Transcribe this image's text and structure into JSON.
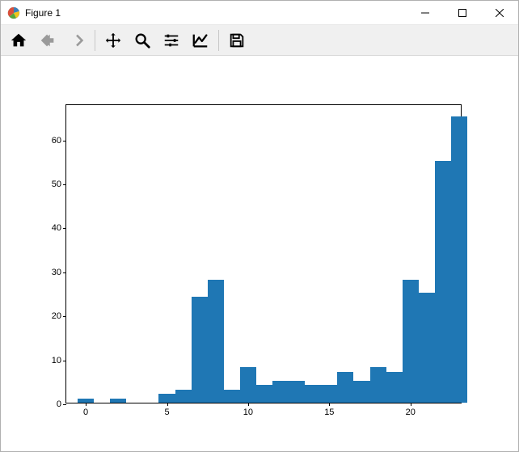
{
  "window": {
    "title": "Figure 1"
  },
  "toolbar": {
    "home": "Home",
    "back": "Back",
    "forward": "Forward",
    "pan": "Pan",
    "zoom": "Zoom",
    "subplots": "Configure subplots",
    "axes": "Edit axis",
    "save": "Save"
  },
  "chart_data": {
    "type": "bar",
    "xlim": [
      -1.2,
      23.2
    ],
    "ylim": [
      0,
      68
    ],
    "x_ticks": [
      0,
      5,
      10,
      15,
      20
    ],
    "y_ticks": [
      0,
      10,
      20,
      30,
      40,
      50,
      60
    ],
    "x_tick_labels": [
      "0",
      "5",
      "10",
      "15",
      "20"
    ],
    "y_tick_labels": [
      "0",
      "10",
      "20",
      "30",
      "40",
      "50",
      "60"
    ],
    "bars": [
      {
        "x": 0,
        "h": 1
      },
      {
        "x": 2,
        "h": 1
      },
      {
        "x": 5,
        "h": 2
      },
      {
        "x": 6,
        "h": 3
      },
      {
        "x": 7,
        "h": 24
      },
      {
        "x": 8,
        "h": 28
      },
      {
        "x": 9,
        "h": 3
      },
      {
        "x": 10,
        "h": 8
      },
      {
        "x": 11,
        "h": 4
      },
      {
        "x": 12,
        "h": 5
      },
      {
        "x": 13,
        "h": 5
      },
      {
        "x": 14,
        "h": 4
      },
      {
        "x": 15,
        "h": 4
      },
      {
        "x": 16,
        "h": 7
      },
      {
        "x": 17,
        "h": 5
      },
      {
        "x": 18,
        "h": 8
      },
      {
        "x": 19,
        "h": 7
      },
      {
        "x": 20,
        "h": 28
      },
      {
        "x": 21,
        "h": 25
      },
      {
        "x": 22,
        "h": 55
      },
      {
        "x": 23,
        "h": 65
      }
    ],
    "bar_width": 1.0,
    "title": "",
    "xlabel": "",
    "ylabel": ""
  }
}
